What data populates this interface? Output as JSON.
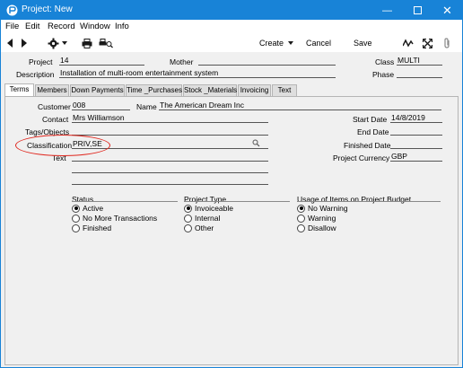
{
  "window": {
    "title": "Project: New"
  },
  "menu": [
    "File",
    "Edit",
    "Record",
    "Window",
    "Info"
  ],
  "toolbar": {
    "create": "Create",
    "cancel": "Cancel",
    "save": "Save"
  },
  "header": {
    "project_label": "Project",
    "project_value": "14",
    "mother_label": "Mother",
    "mother_value": "",
    "class_label": "Class",
    "class_value": "MULTI",
    "description_label": "Description",
    "description_value": "Installation of multi-room entertainment system",
    "phase_label": "Phase",
    "phase_value": ""
  },
  "tabs": [
    "Terms",
    "Members",
    "Down Payments",
    "Time _Purchases",
    "Stock _Materials",
    "Invoicing",
    "Text"
  ],
  "terms": {
    "customer_label": "Customer",
    "customer_value": "008",
    "name_label": "Name",
    "name_value": "The American Dream Inc",
    "contact_label": "Contact",
    "contact_value": "Mrs Williamson",
    "tags_label": "Tags/Objects",
    "tags_value": "",
    "classification_label": "Classification",
    "classification_value": "PRIV,SE",
    "text_label": "Text",
    "start_date_label": "Start Date",
    "start_date_value": "14/8/2019",
    "end_date_label": "End Date",
    "end_date_value": "",
    "finished_date_label": "Finished Date",
    "finished_date_value": "",
    "currency_label": "Project Currency",
    "currency_value": "GBP"
  },
  "status": {
    "title": "Status",
    "options": [
      "Active",
      "No More Transactions",
      "Finished"
    ],
    "selected": "Active"
  },
  "project_type": {
    "title": "Project Type",
    "options": [
      "Invoiceable",
      "Internal",
      "Other"
    ],
    "selected": "Invoiceable"
  },
  "usage": {
    "title": "Usage of Items on Project Budget",
    "options": [
      "No Warning",
      "Warning",
      "Disallow"
    ],
    "selected": "No Warning"
  },
  "colors": {
    "titlebar": "#1883d7",
    "highlight_ellipse": "#e0261d"
  }
}
